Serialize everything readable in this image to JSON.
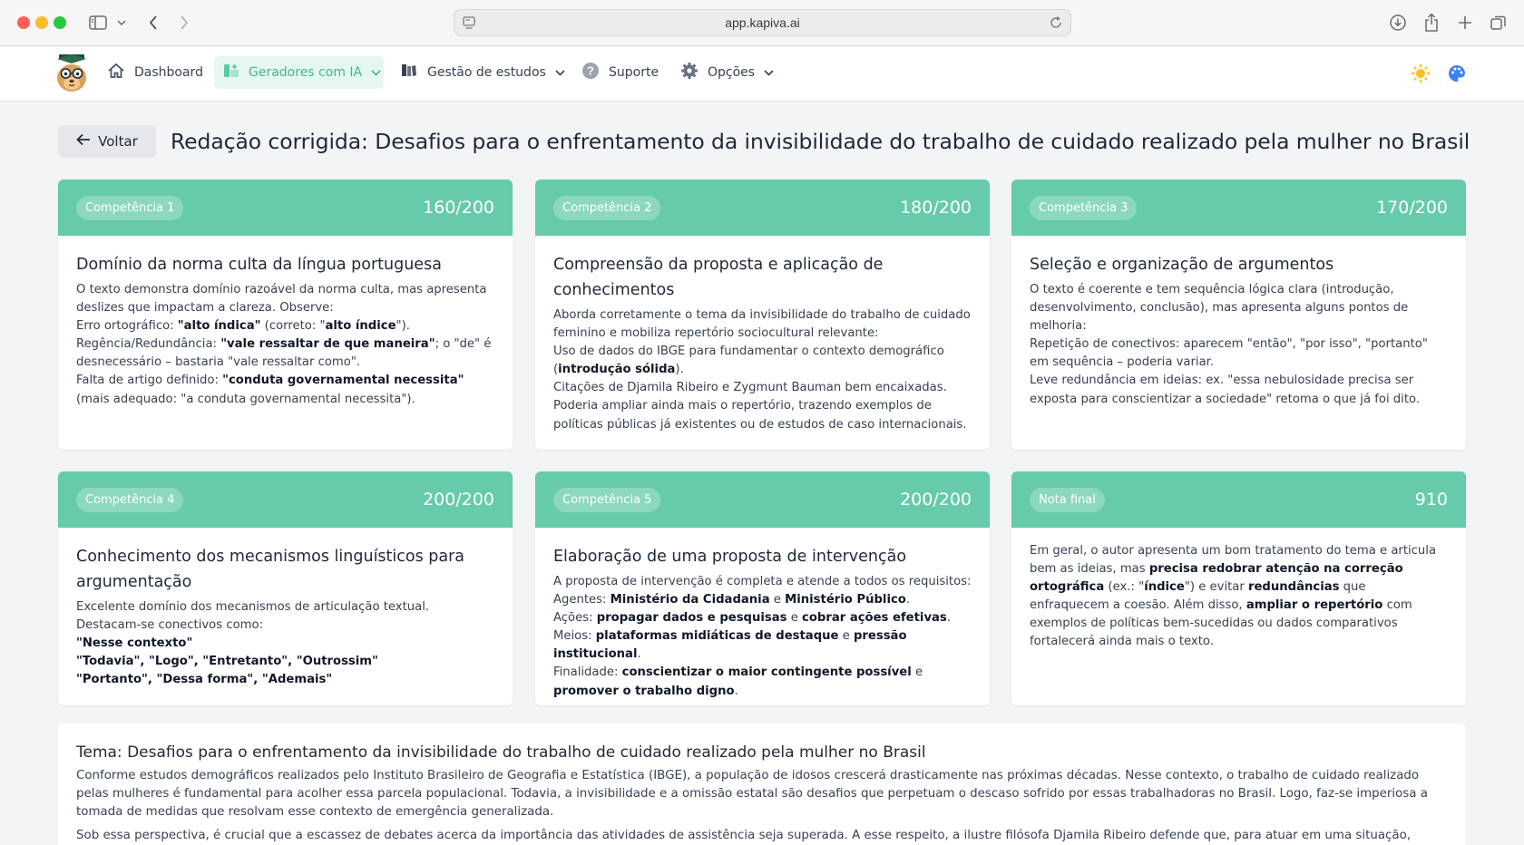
{
  "browser": {
    "url": "app.kapiva.ai",
    "colors": {
      "red": "#ff5f57",
      "yellow": "#febc2e",
      "green": "#28c840"
    }
  },
  "nav": {
    "items": [
      {
        "label": "Dashboard",
        "icon": "home-icon"
      },
      {
        "label": "Geradores com IA",
        "icon": "ai-generator-icon",
        "active": true
      },
      {
        "label": "Gestão de estudos",
        "icon": "books-icon"
      },
      {
        "label": "Suporte",
        "icon": "question-icon"
      },
      {
        "label": "Opções",
        "icon": "gear-icon"
      }
    ],
    "accent_color": "#3fb990"
  },
  "header": {
    "back_label": "Voltar",
    "title": "Redação corrigida: Desafios para o enfrentamento da invisibilidade do trabalho de cuidado realizado pela mulher no Brasil"
  },
  "cards": [
    {
      "badge": "Competência 1",
      "score": "160/200",
      "title": "Domínio da norma culta da língua portuguesa",
      "lines": [
        [
          {
            "t": "O texto demonstra domínio razoável da norma culta, mas apresenta deslizes que impactam a clareza. Observe:"
          }
        ],
        [
          {
            "t": "Erro ortográfico: "
          },
          {
            "t": "\"alto índica\"",
            "b": true
          },
          {
            "t": " (correto: \""
          },
          {
            "t": "alto índice",
            "b": true
          },
          {
            "t": "\")."
          }
        ],
        [
          {
            "t": "Regência/Redundância: "
          },
          {
            "t": "\"vale ressaltar de que maneira\"",
            "b": true
          },
          {
            "t": "; o \"de\" é desnecessário – bastaria \"vale ressaltar como\"."
          }
        ],
        [
          {
            "t": "Falta de artigo definido: "
          },
          {
            "t": "\"conduta governamental necessita\"",
            "b": true
          },
          {
            "t": " (mais adequado: \"a conduta governamental necessita\")."
          }
        ]
      ]
    },
    {
      "badge": "Competência 2",
      "score": "180/200",
      "title": "Compreensão da proposta e aplicação de conhecimentos",
      "lines": [
        [
          {
            "t": "Aborda corretamente o tema da invisibilidade do trabalho de cuidado feminino e mobiliza repertório sociocultural relevante:"
          }
        ],
        [
          {
            "t": "Uso de dados do IBGE para fundamentar o contexto demográfico ("
          },
          {
            "t": "introdução sólida",
            "b": true
          },
          {
            "t": ")."
          }
        ],
        [
          {
            "t": "Citações de Djamila Ribeiro e Zygmunt Bauman bem encaixadas."
          }
        ],
        [
          {
            "t": "Poderia ampliar ainda mais o repertório, trazendo exemplos de políticas públicas já existentes ou de estudos de caso internacionais."
          }
        ]
      ]
    },
    {
      "badge": "Competência 3",
      "score": "170/200",
      "title": "Seleção e organização de argumentos",
      "lines": [
        [
          {
            "t": "O texto é coerente e tem sequência lógica clara (introdução, desenvolvimento, conclusão), mas apresenta alguns pontos de melhoria:"
          }
        ],
        [
          {
            "t": "Repetição de conectivos: aparecem \"então\", \"por isso\", \"portanto\" em sequência – poderia variar."
          }
        ],
        [
          {
            "t": "Leve redundância em ideias: ex. \"essa nebulosidade precisa ser exposta para conscientizar a sociedade\" retoma o que já foi dito."
          }
        ]
      ]
    },
    {
      "badge": "Competência 4",
      "score": "200/200",
      "title": "Conhecimento dos mecanismos linguísticos para argumentação",
      "lines": [
        [
          {
            "t": "Excelente domínio dos mecanismos de articulação textual. Destacam-se conectivos como:"
          }
        ],
        [
          {
            "t": "\"Nesse contexto\"",
            "b": true
          }
        ],
        [
          {
            "t": "\"Todavia\", \"Logo\", \"Entretanto\", \"Outrossim\"",
            "b": true
          }
        ],
        [
          {
            "t": "\"Portanto\", \"Dessa forma\", \"Ademais\"",
            "b": true
          }
        ]
      ]
    },
    {
      "badge": "Competência 5",
      "score": "200/200",
      "title": "Elaboração de uma proposta de intervenção",
      "lines": [
        [
          {
            "t": "A proposta de intervenção é completa e atende a todos os requisitos:"
          }
        ],
        [
          {
            "t": "Agentes: "
          },
          {
            "t": "Ministério da Cidadania",
            "b": true
          },
          {
            "t": " e "
          },
          {
            "t": "Ministério Público",
            "b": true
          },
          {
            "t": "."
          }
        ],
        [
          {
            "t": "Ações: "
          },
          {
            "t": "propagar dados e pesquisas",
            "b": true
          },
          {
            "t": " e "
          },
          {
            "t": "cobrar ações efetivas",
            "b": true
          },
          {
            "t": "."
          }
        ],
        [
          {
            "t": "Meios: "
          },
          {
            "t": "plataformas midiáticas de destaque",
            "b": true
          },
          {
            "t": " e "
          },
          {
            "t": "pressão institucional",
            "b": true
          },
          {
            "t": "."
          }
        ],
        [
          {
            "t": "Finalidade: "
          },
          {
            "t": "conscientizar o maior contingente possível",
            "b": true
          },
          {
            "t": " e "
          },
          {
            "t": "promover o trabalho digno",
            "b": true
          },
          {
            "t": "."
          }
        ]
      ]
    },
    {
      "badge": "Nota final",
      "score": "910",
      "title": "",
      "lines": [
        [
          {
            "t": "Em geral, o autor apresenta um bom tratamento do tema e articula bem as ideias, mas "
          },
          {
            "t": "precisa redobrar atenção na correção ortográfica",
            "b": true
          },
          {
            "t": " (ex.: \""
          },
          {
            "t": "índice",
            "b": true
          },
          {
            "t": "\") e evitar "
          },
          {
            "t": "redundâncias",
            "b": true
          },
          {
            "t": " que enfraquecem a coesão. Além disso, "
          },
          {
            "t": "ampliar o repertório",
            "b": true
          },
          {
            "t": " com exemplos de políticas bem-sucedidas ou dados comparativos fortalecerá ainda mais o texto."
          }
        ]
      ]
    }
  ],
  "essay": {
    "title": "Tema: Desafios para o enfrentamento da invisibilidade do trabalho de cuidado realizado pela mulher no Brasil",
    "paragraphs": [
      "Conforme estudos demográficos realizados pelo Instituto Brasileiro de Geografia e Estatística (IBGE), a população de idosos crescerá drasticamente nas próximas décadas. Nesse contexto, o trabalho de cuidado realizado pelas mulheres é fundamental para acolher essa parcela populacional. Todavia, a invisibilidade e a omissão estatal são desafios que perpetuam o descaso sofrido por essas trabalhadoras no Brasil. Logo, faz-se imperiosa a tomada de medidas que resolvam esse contexto de emergência generalizada.",
      "Sob essa perspectiva, é crucial que a escassez de debates acerca da importância das atividades de assistência seja superada. A esse respeito, a ilustre filósofa Djamila Ribeiro defende que, para atuar em uma situação, deve-se"
    ]
  },
  "colors": {
    "card_header": "#66cbaa",
    "page_bg": "#f3f4f6"
  }
}
